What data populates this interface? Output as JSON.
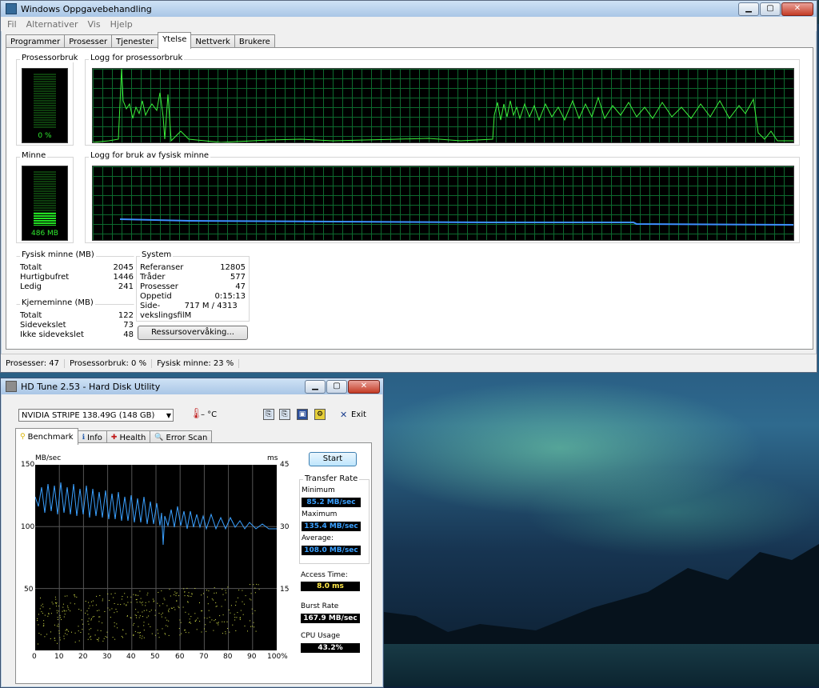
{
  "taskmanager": {
    "title": "Windows Oppgavebehandling",
    "menu": [
      "Fil",
      "Alternativer",
      "Vis",
      "Hjelp"
    ],
    "tabs": [
      "Programmer",
      "Prosesser",
      "Tjenester",
      "Ytelse",
      "Nettverk",
      "Brukere"
    ],
    "active_tab": "Ytelse",
    "cpu_label": "Prosessorbruk",
    "cpu_value": "0 %",
    "cpu_fraction": 0.0,
    "cpu_history_label": "Logg for prosessorbruk",
    "mem_label": "Minne",
    "mem_value": "486 MB",
    "mem_fraction": 0.24,
    "mem_history_label": "Logg for bruk av fysisk minne",
    "physical_memory": {
      "label": "Fysisk minne (MB)",
      "rows": [
        {
          "name": "Totalt",
          "value": "2045"
        },
        {
          "name": "Hurtigbufret",
          "value": "1446"
        },
        {
          "name": "Ledig",
          "value": "241"
        }
      ]
    },
    "kernel_memory": {
      "label": "Kjerneminne (MB)",
      "rows": [
        {
          "name": "Totalt",
          "value": "122"
        },
        {
          "name": "Sidevekslet",
          "value": "73"
        },
        {
          "name": "Ikke sidevekslet",
          "value": "48"
        }
      ]
    },
    "system": {
      "label": "System",
      "rows": [
        {
          "name": "Referanser",
          "value": "12805"
        },
        {
          "name": "Tråder",
          "value": "577"
        },
        {
          "name": "Prosesser",
          "value": "47"
        },
        {
          "name": "Oppetid",
          "value": "0:15:13"
        },
        {
          "name": "Side-\nvekslingsfil",
          "value": "717 M / 4313 M"
        }
      ]
    },
    "resource_button": "Ressursovervåking...",
    "status": [
      "Prosesser: 47",
      "Prosessorbruk: 0 %",
      "Fysisk minne: 23 %"
    ]
  },
  "hdtune": {
    "title": "HD Tune 2.53 - Hard Disk Utility",
    "drive": "NVIDIA  STRIPE   138.49G (148 GB)",
    "temperature": "– °C",
    "exit_label": "Exit",
    "tabs": [
      "Benchmark",
      "Info",
      "Health",
      "Error Scan"
    ],
    "active_tab": "Benchmark",
    "start_label": "Start",
    "y_left_unit": "MB/sec",
    "y_right_unit": "ms",
    "y_left_ticks": [
      "150",
      "100",
      "50"
    ],
    "y_right_ticks": [
      "45",
      "30",
      "15"
    ],
    "x_ticks": [
      "0",
      "10",
      "20",
      "30",
      "40",
      "50",
      "60",
      "70",
      "80",
      "90",
      "100%"
    ],
    "transfer_rate_label": "Transfer Rate",
    "minimum_label": "Minimum",
    "minimum": "85.2 MB/sec",
    "maximum_label": "Maximum",
    "maximum": "135.4 MB/sec",
    "average_label": "Average:",
    "average": "108.0 MB/sec",
    "access_label": "Access Time:",
    "access": "8.0 ms",
    "burst_label": "Burst Rate",
    "burst": "167.9 MB/sec",
    "cpu_label": "CPU Usage",
    "cpu": "43.2%"
  }
}
